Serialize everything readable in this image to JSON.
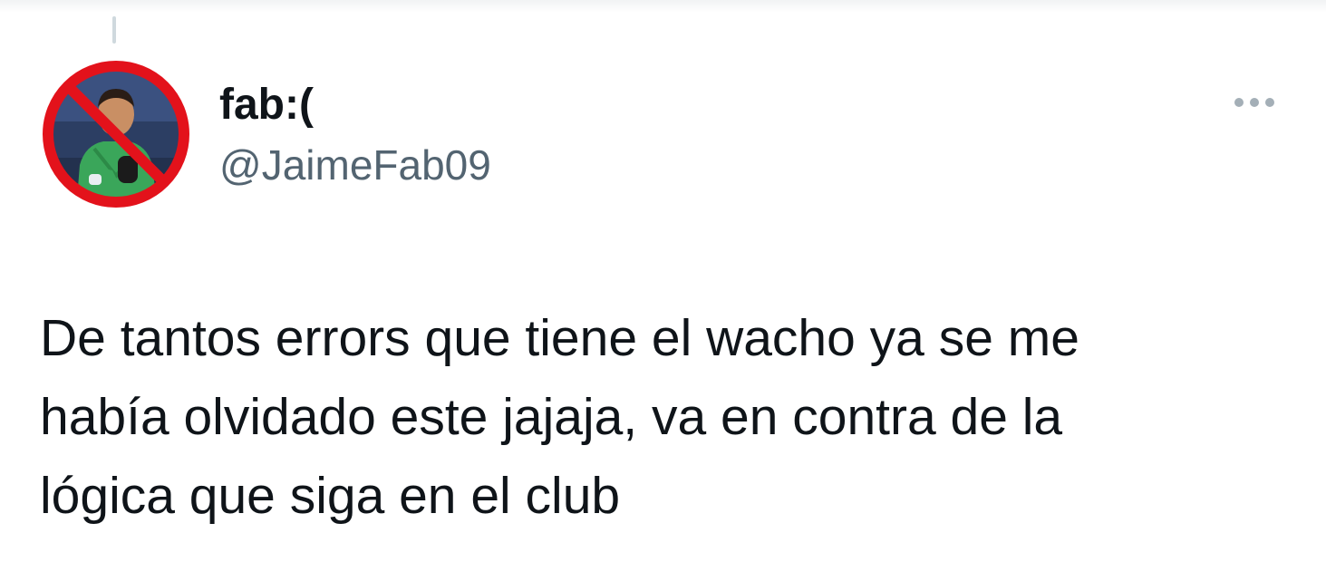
{
  "tweet": {
    "author": {
      "display_name": "fab:(",
      "handle": "@JaimeFab09"
    },
    "text_lines": [
      "De tantos errors que tiene el wacho ya se me",
      "había olvidado este jajaja, va en contra de la",
      "lógica que siga en el club"
    ],
    "more_icon": "more-horizontal-icon"
  },
  "colors": {
    "text_primary": "#0f1419",
    "text_secondary": "#536471",
    "prohibition_red": "#e3121b",
    "jersey_green": "#3aa65a"
  }
}
